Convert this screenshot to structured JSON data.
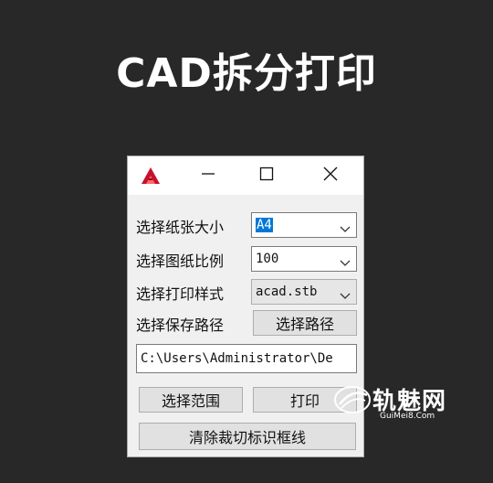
{
  "headline": "CAD拆分打印",
  "window": {
    "titlebar": {
      "app_icon": "autocad-a-icon",
      "minimize_icon": "minimize-icon",
      "maximize_icon": "maximize-icon",
      "close_icon": "close-icon"
    },
    "paper_size": {
      "label": "选择纸张大小",
      "value": "A4"
    },
    "drawing_scale": {
      "label": "选择图纸比例",
      "value": "100"
    },
    "print_style": {
      "label": "选择打印样式",
      "value": "acad.stb"
    },
    "save_path": {
      "label": "选择保存路径",
      "button": "选择路径",
      "value": "C:\\Users\\Administrator\\De"
    },
    "select_range_button": "选择范围",
    "print_button": "打印",
    "clear_button": "清除裁切标识框线"
  },
  "watermark": {
    "name": "轨魅网",
    "url": "GuiMei8.Com"
  },
  "colors": {
    "background": "#282828",
    "dialog": "#f0f0f0",
    "selection": "#0078d7",
    "autocad_red": "#c8102e"
  }
}
